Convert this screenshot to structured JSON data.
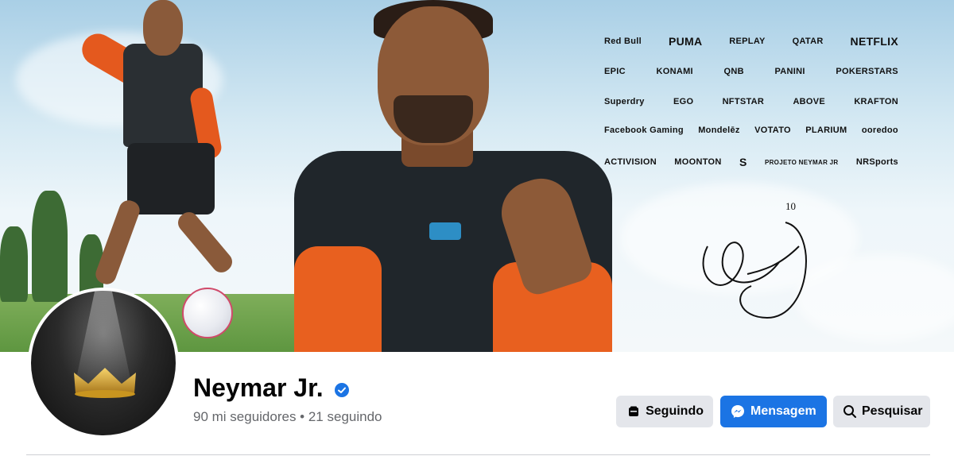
{
  "profile": {
    "name": "Neymar Jr.",
    "stats": "90 mi seguidores • 21 seguindo",
    "verified": true
  },
  "actions": {
    "following_label": "Seguindo",
    "message_label": "Mensagem",
    "search_label": "Pesquisar"
  },
  "cover": {
    "sponsors": [
      [
        "Red Bull",
        "PUMA",
        "REPLAY",
        "QATAR",
        "NETFLIX"
      ],
      [
        "EPIC",
        "KONAMI",
        "QNB",
        "PANINI",
        "POKERSTARS"
      ],
      [
        "Superdry",
        "EGO",
        "NFTSTAR",
        "ABOVE",
        "KRAFTON"
      ],
      [
        "Facebook Gaming",
        "Mondelēz",
        "VOTATO",
        "PLARIUM",
        "ooredoo"
      ],
      [
        "ACTIVISION",
        "MOONTON",
        "S",
        "PROJETO NEYMAR JR",
        "NRSports"
      ]
    ],
    "signature_number": "10"
  },
  "colors": {
    "primary": "#1b74e4",
    "secondary_button": "#e4e6eb",
    "muted_text": "#65676b",
    "verified": "#1b74e4"
  }
}
